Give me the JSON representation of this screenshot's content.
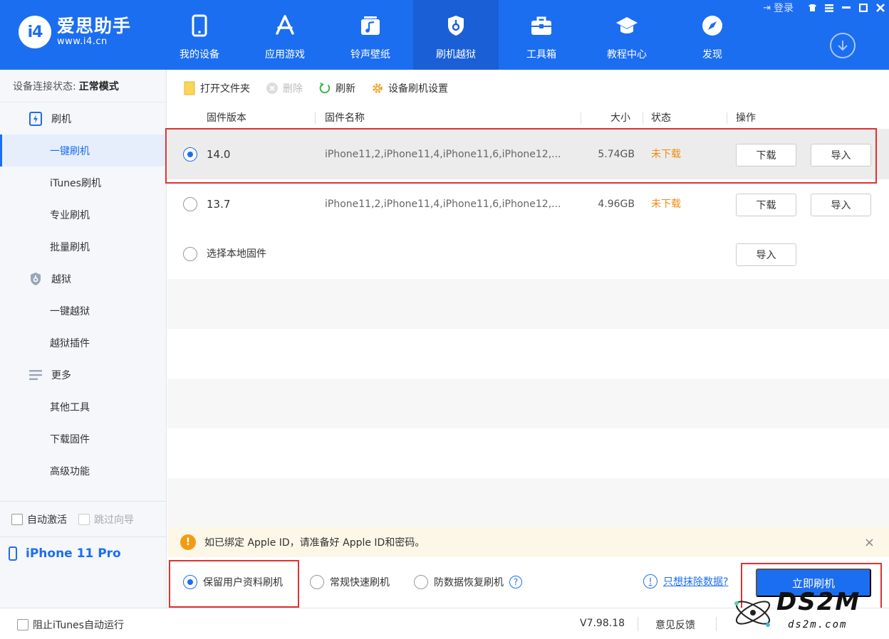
{
  "brand": {
    "name": "爱思助手",
    "url": "www.i4.cn",
    "logo_mark": "i4"
  },
  "nav": [
    {
      "label": "我的设备",
      "icon": "phone-icon"
    },
    {
      "label": "应用游戏",
      "icon": "appstore-icon"
    },
    {
      "label": "铃声壁纸",
      "icon": "music-icon"
    },
    {
      "label": "刷机越狱",
      "icon": "shield-icon"
    },
    {
      "label": "工具箱",
      "icon": "toolbox-icon"
    },
    {
      "label": "教程中心",
      "icon": "graduation-cap-icon"
    },
    {
      "label": "发现",
      "icon": "compass-icon"
    }
  ],
  "topbar": {
    "login": "登录"
  },
  "sidebar": {
    "status_label": "设备连接状态:",
    "status_value": "正常模式",
    "groups": [
      {
        "label": "刷机",
        "icon": "flash-icon",
        "items": [
          "一键刷机",
          "iTunes刷机",
          "专业刷机",
          "批量刷机"
        ]
      },
      {
        "label": "越狱",
        "icon": "jailbreak-shield-icon",
        "items": [
          "一键越狱",
          "越狱插件"
        ]
      },
      {
        "label": "更多",
        "icon": "menu-icon",
        "items": [
          "其他工具",
          "下载固件",
          "高级功能"
        ]
      }
    ],
    "auto_activate": "自动激活",
    "skip_guide": "跳过向导",
    "device_name": "iPhone 11 Pro"
  },
  "toolbar": {
    "open_folder": "打开文件夹",
    "delete": "删除",
    "refresh": "刷新",
    "settings": "设备刷机设置"
  },
  "table": {
    "headers": {
      "version": "固件版本",
      "name": "固件名称",
      "size": "大小",
      "status": "状态",
      "actions": "操作"
    },
    "rows": [
      {
        "version": "14.0",
        "name": "iPhone11,2,iPhone11,4,iPhone11,6,iPhone12,...",
        "size": "5.74GB",
        "status": "未下载",
        "download": "下载",
        "import": "导入",
        "selected": true
      },
      {
        "version": "13.7",
        "name": "iPhone11,2,iPhone11,4,iPhone11,6,iPhone12,...",
        "size": "4.96GB",
        "status": "未下载",
        "download": "下载",
        "import": "导入",
        "selected": false
      }
    ],
    "local": {
      "label": "选择本地固件",
      "import": "导入"
    }
  },
  "notice": {
    "text": "如已绑定 Apple ID，请准备好 Apple ID和密码。",
    "close": "×"
  },
  "options": {
    "keep_data": "保留用户资料刷机",
    "quick": "常规快速刷机",
    "anti_recovery": "防数据恢复刷机",
    "help": "?",
    "erase_link": "只想抹除数据?",
    "flash_now": "立即刷机"
  },
  "statusbar": {
    "block_itunes": "阻止iTunes自动运行",
    "version": "V7.98.18",
    "feedback": "意见反馈"
  },
  "watermark": {
    "title": "DS2M",
    "sub": "ds2m.com"
  },
  "colors": {
    "primary": "#1c6ef0",
    "warning": "#ef8c10",
    "highlight": "#e03131"
  }
}
